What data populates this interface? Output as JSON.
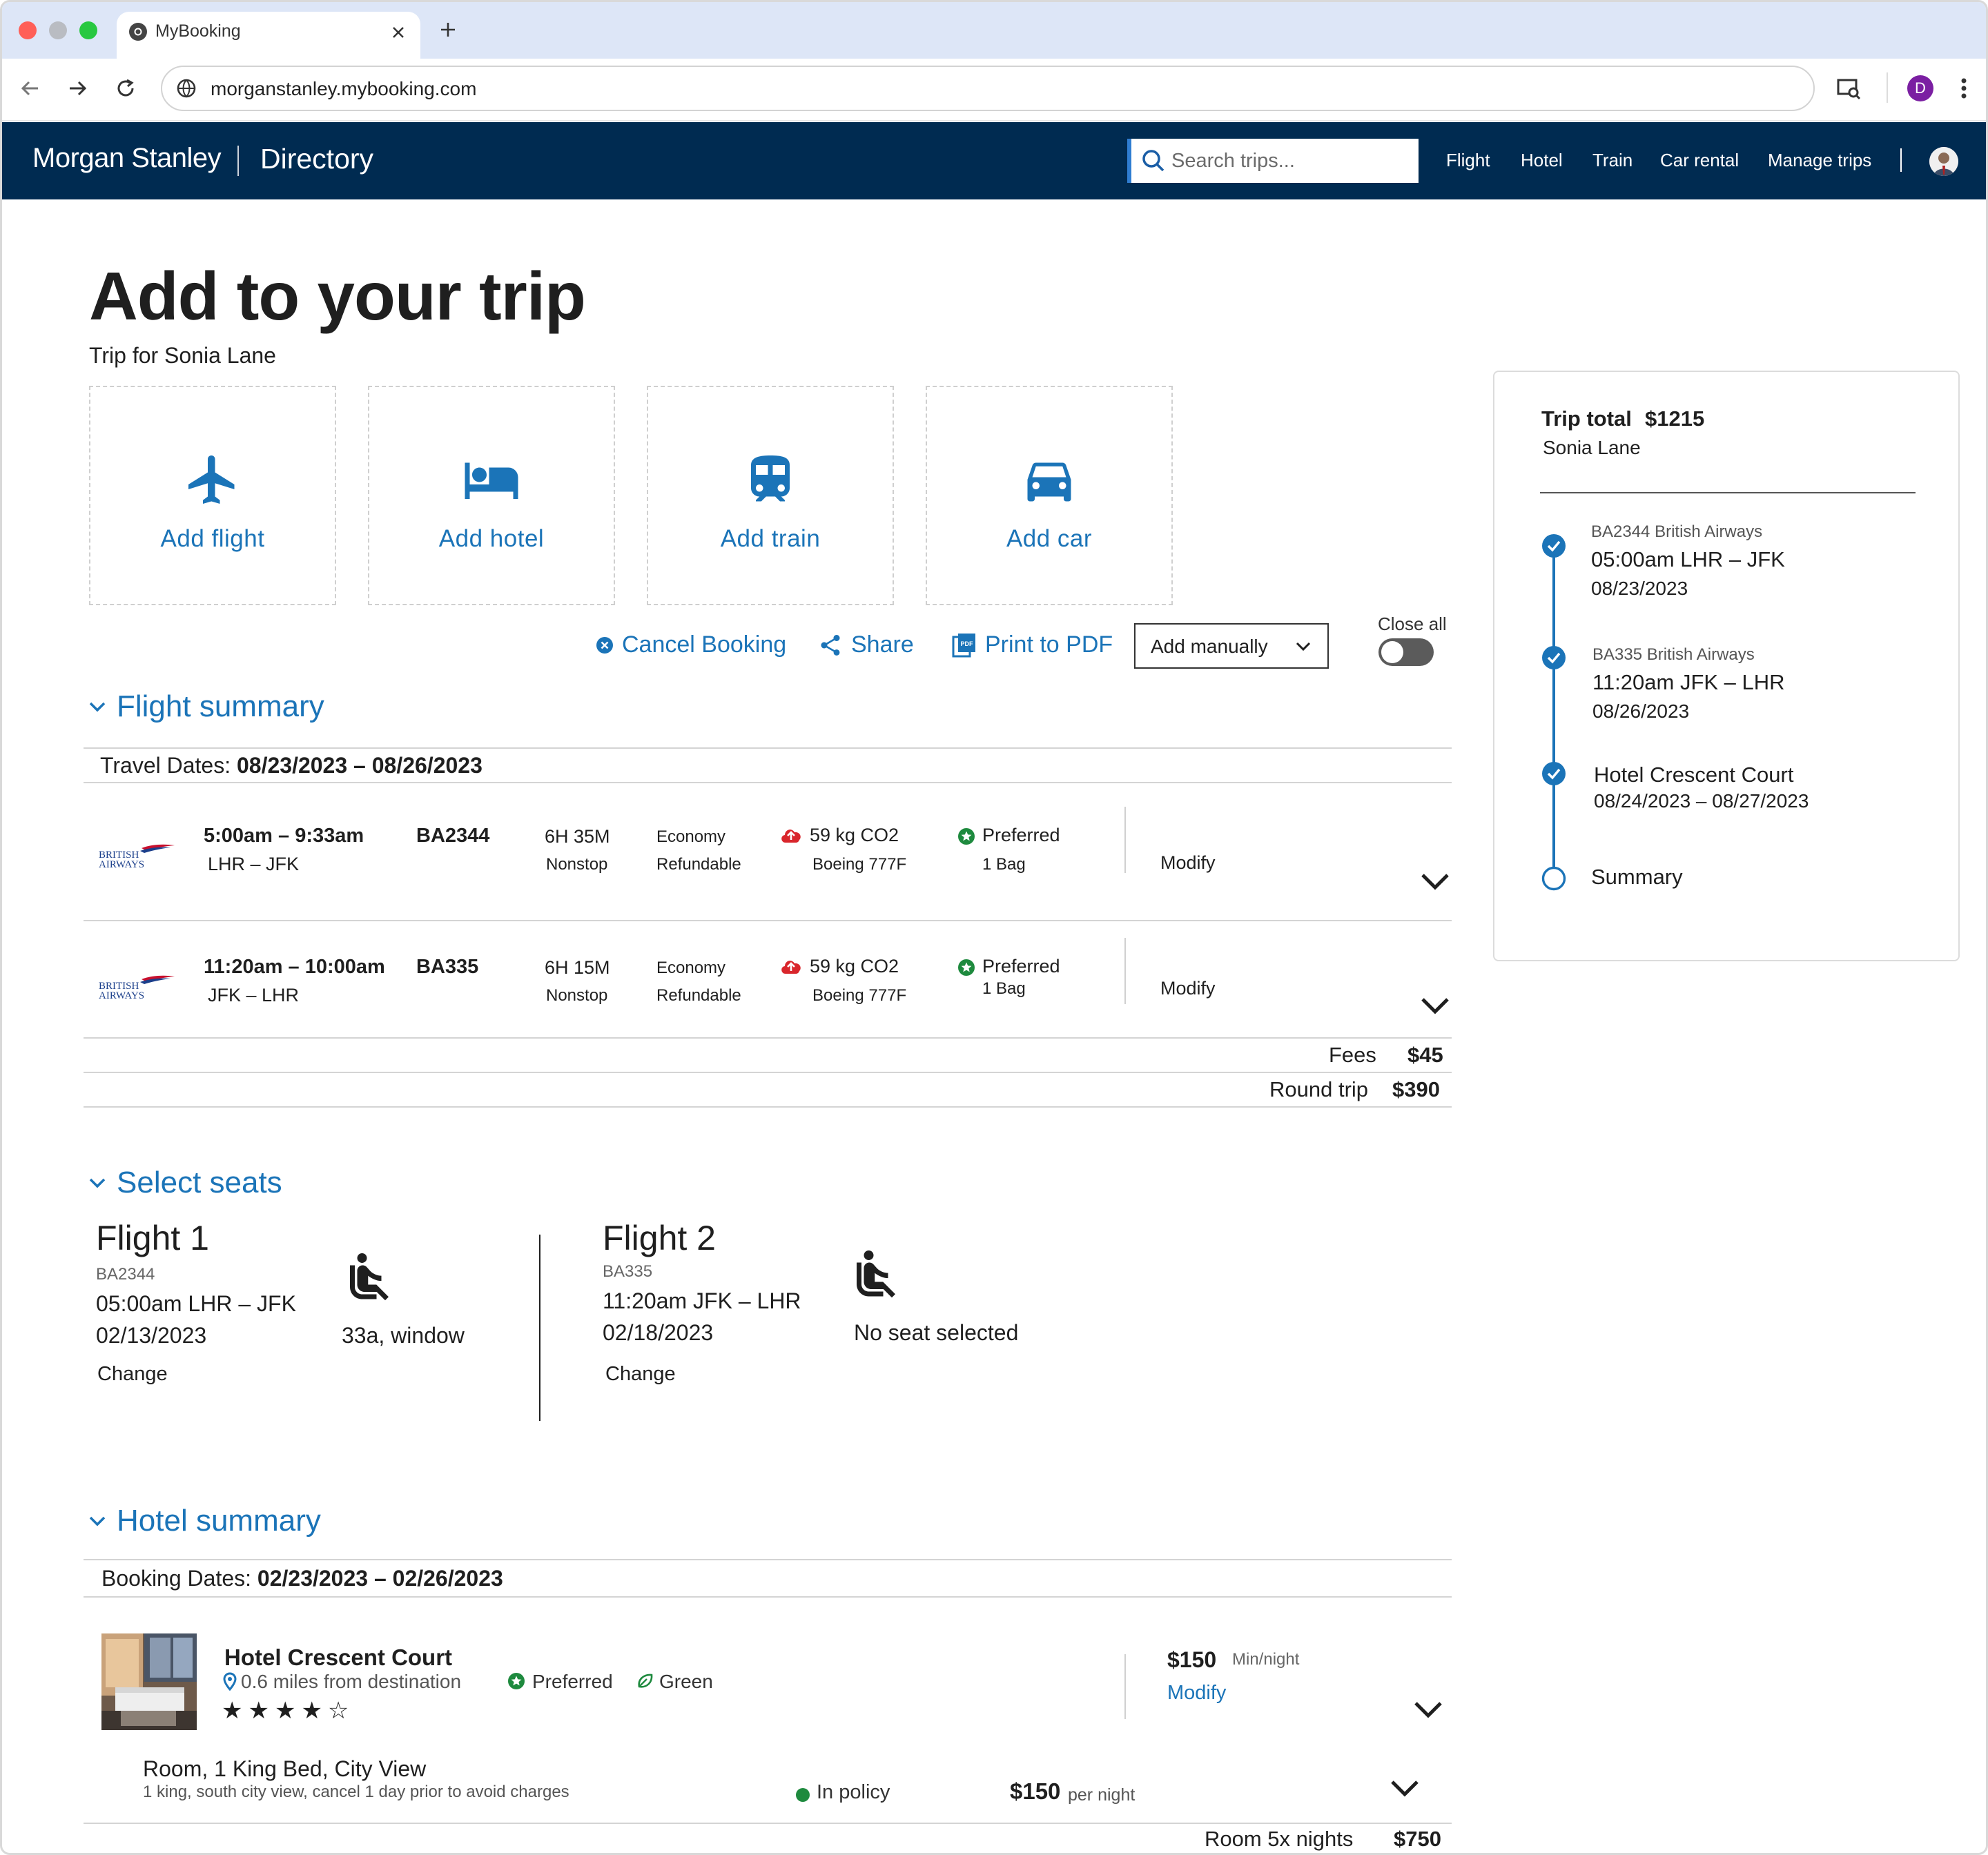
{
  "browser": {
    "tab_title": "MyBooking",
    "url": "morganstanley.mybooking.com",
    "profile_initial": "D"
  },
  "nav": {
    "brand": "Morgan Stanley",
    "section": "Directory",
    "search_placeholder": "Search trips...",
    "links": [
      "Flight",
      "Hotel",
      "Train",
      "Car rental",
      "Manage trips"
    ]
  },
  "page": {
    "title": "Add to your trip",
    "trip_for": "Trip for Sonia Lane"
  },
  "add_options": [
    {
      "label": "Add flight",
      "icon": "plane-icon"
    },
    {
      "label": "Add hotel",
      "icon": "bed-icon"
    },
    {
      "label": "Add train",
      "icon": "train-icon"
    },
    {
      "label": "Add car",
      "icon": "car-icon"
    }
  ],
  "actions": {
    "cancel": "Cancel Booking",
    "share": "Share",
    "print": "Print to PDF",
    "add_manually": "Add manually",
    "close_all": "Close all"
  },
  "flight_summary": {
    "heading": "Flight summary",
    "dates_label": "Travel Dates:",
    "dates_value": "08/23/2023 – 08/26/2023",
    "flights": [
      {
        "airline_logo": "BRITISH AIRWAYS",
        "times": "5:00am – 9:33am",
        "route": "LHR – JFK",
        "number": "BA2344",
        "duration": "6H 35M",
        "stops": "Nonstop",
        "cabin": "Economy",
        "refund": "Refundable",
        "co2": "59 kg CO2",
        "aircraft": "Boeing 777F",
        "preferred": "Preferred",
        "bags": "1 Bag",
        "modify": "Modify"
      },
      {
        "airline_logo": "BRITISH AIRWAYS",
        "times": "11:20am – 10:00am",
        "route": "JFK – LHR",
        "number": "BA335",
        "duration": "6H 15M",
        "stops": "Nonstop",
        "cabin": "Economy",
        "refund": "Refundable",
        "co2": "59 kg CO2",
        "aircraft": "Boeing 777F",
        "preferred": "Preferred",
        "bags": "1 Bag",
        "modify": "Modify"
      }
    ],
    "fees_label": "Fees",
    "fees_value": "$45",
    "total_label": "Round trip",
    "total_value": "$390"
  },
  "seats": {
    "heading": "Select seats",
    "flights": [
      {
        "title": "Flight 1",
        "code": "BA2344",
        "route": "05:00am LHR – JFK",
        "date": "02/13/2023",
        "change": "Change",
        "seat": "33a, window"
      },
      {
        "title": "Flight 2",
        "code": "BA335",
        "route": "11:20am JFK – LHR",
        "date": "02/18/2023",
        "change": "Change",
        "seat": "No seat selected"
      }
    ]
  },
  "hotel_summary": {
    "heading": "Hotel summary",
    "dates_label": "Booking Dates:",
    "dates_value": "02/23/2023 – 02/26/2023",
    "hotel": {
      "name": "Hotel Crescent Court",
      "distance": "0.6 miles from destination",
      "preferred": "Preferred",
      "green": "Green",
      "stars": "★★★★☆",
      "rating": 4,
      "price": "$150",
      "price_unit": "Min/night",
      "modify": "Modify"
    },
    "room": {
      "title": "Room, 1 King Bed, City View",
      "desc": "1 king, south city view, cancel 1 day prior to avoid charges",
      "policy": "In policy",
      "price": "$150",
      "price_unit": "per night"
    },
    "total_label": "Room 5x nights",
    "total_value": "$750"
  },
  "trip_card": {
    "total_label": "Trip total",
    "total_value": "$1215",
    "traveler": "Sonia Lane",
    "steps": [
      {
        "sub": "BA2344 British Airways",
        "main": "05:00am LHR – JFK",
        "date": "08/23/2023",
        "done": true
      },
      {
        "sub": "BA335 British Airways",
        "main": "11:20am JFK – LHR",
        "date": "08/26/2023",
        "done": true
      },
      {
        "sub": "",
        "main": "Hotel Crescent Court",
        "date": "08/24/2023 – 08/27/2023",
        "done": true
      },
      {
        "sub": "",
        "main": "Summary",
        "date": "",
        "done": false
      }
    ]
  },
  "colors": {
    "nav_bg": "#002b51",
    "accent": "#1b74b8",
    "co2_red": "#d9262c",
    "preferred_green": "#1e8a3e"
  }
}
